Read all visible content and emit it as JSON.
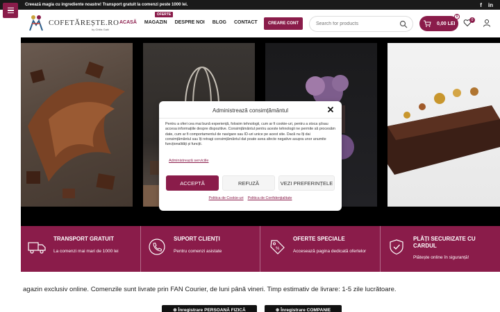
{
  "topbar": {
    "message": "Creează magia cu ingrediente noastre! Transport gratuit la comenzi peste 1000 lei.",
    "social": [
      "facebook-icon",
      "linkedin-icon"
    ]
  },
  "header": {
    "logo_text": "COFETĂREȘTE.RO",
    "logo_sub": "by Ghitis Gabi",
    "nav": [
      {
        "label": "ACASĂ",
        "active": true
      },
      {
        "label": "MAGAZIN",
        "badge": "OFERTE"
      },
      {
        "label": "DESPRE NOI"
      },
      {
        "label": "BLOG"
      },
      {
        "label": "CONTACT"
      }
    ],
    "account_button": "CREARE CONT",
    "search_placeholder": "Search for products",
    "cart_total": "0,00 LEI",
    "cart_count": "0",
    "wishlist_count": "0"
  },
  "features": [
    {
      "title": "TRANSPORT GRATUIT",
      "text": "La comenzi mai mari de 1000 lei",
      "icon": "truck-icon"
    },
    {
      "title": "SUPORT CLIENȚI",
      "text": "Pentru comenzi asistate",
      "icon": "phone-icon"
    },
    {
      "title": "OFERTE SPECIALE",
      "text": "Accesează pagina dedicată ofertelor",
      "icon": "tag-icon"
    },
    {
      "title": "PLĂȚI SECURIZATE CU CARDUL",
      "text": "Plătește online în siguranță!",
      "icon": "shield-icon"
    }
  ],
  "delivery_text": "agazin exclusiv online. Comenzile sunt livrate prin FAN Courier, de luni până vineri. Timp estimativ de livrare: 1-5 zile lucrătoare.",
  "register_buttons": {
    "person": "⊕ Înregistrare PERSOANĂ FIZICĂ",
    "company": "⊕ Înregistrare COMPANIE"
  },
  "consent": {
    "title": "Administrează consimțământul",
    "body": "Pentru a oferi cea mai bună experiență, folosim tehnologii, cum ar fi cookie-uri, pentru a stoca și/sau accesa informațiile despre dispozitive. Consimțământul pentru aceste tehnologii ne permite să procesăm date, cum ar fi comportamentul de navigare sau ID-uri unice pe acest site. Dacă nu îți dai consimțământul sau îți retragi consimțământul dat poate avea afecte negative asupra unor anumite funcționalități și funcții.",
    "manage_link": "Administrează serviciile",
    "accept": "ACCEPTĂ",
    "refuse": "REFUZĂ",
    "preferences": "VEZI PREFERINȚELE",
    "cookie_policy": "Politica de Cookie-uri",
    "privacy_policy": "Politica de Confidențialitate"
  },
  "colors": {
    "accent": "#8a1c4a",
    "dark": "#1a1a1a"
  }
}
